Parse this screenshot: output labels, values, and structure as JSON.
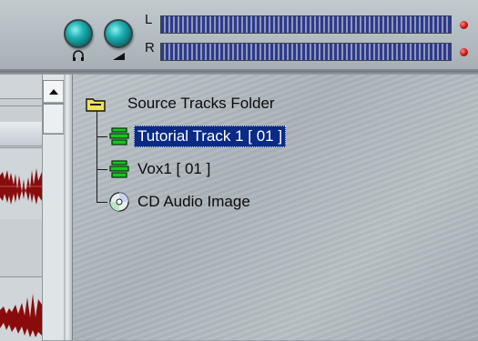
{
  "meters": {
    "left_channel_label": "L",
    "right_channel_label": "R",
    "accent_color": "#2d3a8c",
    "clip_led_color": "#d01818"
  },
  "knobs": [
    {
      "icon": "headphones-icon"
    },
    {
      "icon": "volume-ramp-icon"
    }
  ],
  "tree": {
    "folder": {
      "label": "Source Tracks Folder",
      "icon": "folder-icon"
    },
    "items": [
      {
        "label": "Tutorial  Track 1  [ 01 ]",
        "icon": "audio-track-icon",
        "selected": true
      },
      {
        "label": "Vox1 [ 01 ]",
        "icon": "audio-track-icon",
        "selected": false
      },
      {
        "label": "CD Audio Image",
        "icon": "cd-icon",
        "selected": false
      }
    ],
    "selection_color": "#0a2a86"
  }
}
